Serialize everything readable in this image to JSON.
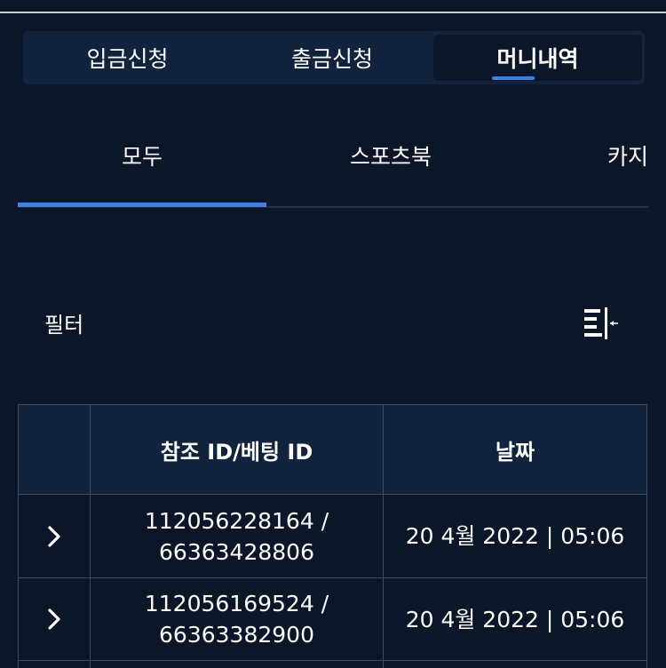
{
  "top_tabs": [
    {
      "label": "입금신청"
    },
    {
      "label": "출금신청"
    },
    {
      "label": "머니내역"
    }
  ],
  "sub_tabs": [
    {
      "label": "모두"
    },
    {
      "label": "스포츠북"
    },
    {
      "label": "카지노"
    }
  ],
  "filter": {
    "label": "필터",
    "icon": "filter-collapse-icon"
  },
  "table": {
    "headers": {
      "expand": "",
      "ref": "참조 ID/베팅 ID",
      "date": "날짜"
    },
    "rows": [
      {
        "ref_line1": "112056228164 /",
        "ref_line2": "66363428806",
        "date": "20 4월 2022 | 05:06"
      },
      {
        "ref_line1": "112056169524 /",
        "ref_line2": "66363382900",
        "date": "20 4월 2022 | 05:06"
      }
    ]
  },
  "colors": {
    "background": "#0b1628",
    "panel": "#12233d",
    "accent": "#3d82e6",
    "border": "#3a4a60"
  }
}
